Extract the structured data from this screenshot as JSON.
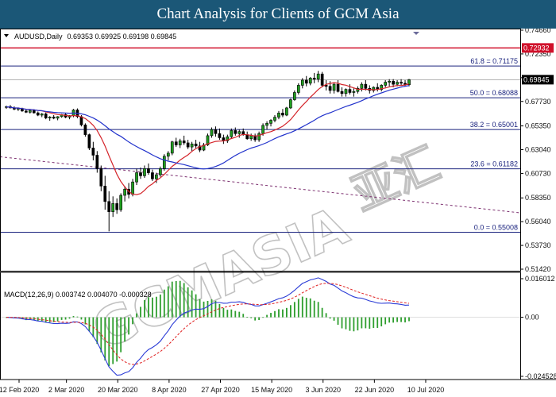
{
  "header": {
    "title": "Chart Analysis for Clients of GCM Asia"
  },
  "info": {
    "symbol": "AUDUSD,Daily",
    "ohlc": "0.69353 0.69925 0.69198 0.69845",
    "macd": "MACD(12,26,9) 0.003742 0.004070 -0.000328"
  },
  "watermark": {
    "text": "GCMASIA",
    "cjk": "亚汇"
  },
  "colors": {
    "bull": "#1f9d1f",
    "bear": "#000000",
    "ma_fast": "#d4242a",
    "ma_slow": "#2233cc",
    "fib": "#1a237e",
    "resistance": "#d0102a",
    "trendline": "#7b2d6e",
    "macd_hist": "#2e9e2e",
    "macd_line": "#2a3bd6",
    "signal_line": "#e02020"
  },
  "chart_data": {
    "type": "candlestick",
    "symbol": "AUDUSD",
    "timeframe": "Daily",
    "ylim": [
      0.5142,
      0.7466
    ],
    "y_ticks": [
      "0.74660",
      "0.72350",
      "0.70040",
      "0.67730",
      "0.65350",
      "0.63040",
      "0.60730",
      "0.58350",
      "0.56040",
      "0.53730",
      "0.51420"
    ],
    "x_ticks": [
      "12 Feb 2020",
      "2 Mar 2020",
      "20 Mar 2020",
      "8 Apr 2020",
      "27 Apr 2020",
      "15 May 2020",
      "3 Jun 2020",
      "22 Jun 2020",
      "10 Jul 2020"
    ],
    "current_price": {
      "value": 0.69845,
      "label": "0.69845"
    },
    "resistance": {
      "value": 0.72932,
      "label": "0.72932"
    },
    "fibonacci": [
      {
        "level": "61.8",
        "value": 0.71175,
        "label": "61.8 = 0.71175"
      },
      {
        "level": "50.0",
        "value": 0.68088,
        "label": "50.0 = 0.68088"
      },
      {
        "level": "38.2",
        "value": 0.65001,
        "label": "38.2 = 0.65001"
      },
      {
        "level": "23.6",
        "value": 0.61182,
        "label": "23.6 = 0.61182"
      },
      {
        "level": "0.0",
        "value": 0.55008,
        "label": "0.0 = 0.55008"
      }
    ],
    "candles": [
      [
        0.6715,
        0.6732,
        0.6702,
        0.6722
      ],
      [
        0.6722,
        0.6738,
        0.6705,
        0.671
      ],
      [
        0.671,
        0.6725,
        0.6688,
        0.6698
      ],
      [
        0.6698,
        0.6715,
        0.668,
        0.6705
      ],
      [
        0.6705,
        0.6712,
        0.6672,
        0.668
      ],
      [
        0.668,
        0.6695,
        0.666,
        0.6668
      ],
      [
        0.6668,
        0.669,
        0.6655,
        0.6685
      ],
      [
        0.6685,
        0.6698,
        0.6655,
        0.6662
      ],
      [
        0.6662,
        0.6675,
        0.663,
        0.664
      ],
      [
        0.664,
        0.666,
        0.662,
        0.6652
      ],
      [
        0.6652,
        0.6665,
        0.66,
        0.6612
      ],
      [
        0.6612,
        0.663,
        0.6585,
        0.6622
      ],
      [
        0.6622,
        0.664,
        0.66,
        0.661
      ],
      [
        0.661,
        0.663,
        0.659,
        0.6625
      ],
      [
        0.6625,
        0.665,
        0.6615,
        0.6645
      ],
      [
        0.6645,
        0.666,
        0.661,
        0.662
      ],
      [
        0.662,
        0.664,
        0.66,
        0.6635
      ],
      [
        0.6635,
        0.67,
        0.662,
        0.669
      ],
      [
        0.669,
        0.6705,
        0.661,
        0.6625
      ],
      [
        0.6625,
        0.664,
        0.653,
        0.6545
      ],
      [
        0.6545,
        0.656,
        0.643,
        0.645
      ],
      [
        0.645,
        0.646,
        0.63,
        0.632
      ],
      [
        0.632,
        0.638,
        0.62,
        0.625
      ],
      [
        0.625,
        0.629,
        0.608,
        0.612
      ],
      [
        0.612,
        0.615,
        0.59,
        0.595
      ],
      [
        0.595,
        0.605,
        0.572,
        0.58
      ],
      [
        0.58,
        0.59,
        0.551,
        0.57
      ],
      [
        0.57,
        0.585,
        0.565,
        0.578
      ],
      [
        0.578,
        0.583,
        0.568,
        0.572
      ],
      [
        0.572,
        0.588,
        0.57,
        0.586
      ],
      [
        0.586,
        0.595,
        0.58,
        0.592
      ],
      [
        0.592,
        0.598,
        0.583,
        0.587
      ],
      [
        0.587,
        0.602,
        0.585,
        0.599
      ],
      [
        0.599,
        0.612,
        0.596,
        0.608
      ],
      [
        0.608,
        0.613,
        0.602,
        0.605
      ],
      [
        0.605,
        0.615,
        0.603,
        0.612
      ],
      [
        0.612,
        0.617,
        0.606,
        0.608
      ],
      [
        0.608,
        0.611,
        0.6,
        0.602
      ],
      [
        0.602,
        0.608,
        0.598,
        0.606
      ],
      [
        0.606,
        0.614,
        0.604,
        0.612
      ],
      [
        0.612,
        0.626,
        0.61,
        0.624
      ],
      [
        0.624,
        0.629,
        0.62,
        0.627
      ],
      [
        0.627,
        0.639,
        0.625,
        0.638
      ],
      [
        0.638,
        0.642,
        0.633,
        0.635
      ],
      [
        0.635,
        0.641,
        0.632,
        0.639
      ],
      [
        0.639,
        0.644,
        0.635,
        0.637
      ],
      [
        0.637,
        0.64,
        0.631,
        0.633
      ],
      [
        0.633,
        0.638,
        0.629,
        0.636
      ],
      [
        0.636,
        0.64,
        0.632,
        0.634
      ],
      [
        0.634,
        0.638,
        0.628,
        0.63
      ],
      [
        0.63,
        0.637,
        0.629,
        0.635
      ],
      [
        0.635,
        0.646,
        0.634,
        0.644
      ],
      [
        0.644,
        0.652,
        0.642,
        0.65
      ],
      [
        0.65,
        0.653,
        0.643,
        0.646
      ],
      [
        0.646,
        0.651,
        0.64,
        0.642
      ],
      [
        0.642,
        0.645,
        0.636,
        0.639
      ],
      [
        0.639,
        0.645,
        0.637,
        0.643
      ],
      [
        0.643,
        0.651,
        0.641,
        0.649
      ],
      [
        0.649,
        0.652,
        0.644,
        0.646
      ],
      [
        0.646,
        0.65,
        0.642,
        0.648
      ],
      [
        0.648,
        0.651,
        0.644,
        0.645
      ],
      [
        0.645,
        0.648,
        0.64,
        0.641
      ],
      [
        0.641,
        0.646,
        0.639,
        0.644
      ],
      [
        0.644,
        0.646,
        0.638,
        0.64
      ],
      [
        0.64,
        0.648,
        0.638,
        0.646
      ],
      [
        0.646,
        0.656,
        0.644,
        0.654
      ],
      [
        0.654,
        0.658,
        0.65,
        0.656
      ],
      [
        0.656,
        0.66,
        0.653,
        0.659
      ],
      [
        0.659,
        0.664,
        0.657,
        0.662
      ],
      [
        0.662,
        0.668,
        0.66,
        0.666
      ],
      [
        0.666,
        0.67,
        0.662,
        0.664
      ],
      [
        0.664,
        0.672,
        0.663,
        0.671
      ],
      [
        0.671,
        0.68,
        0.67,
        0.679
      ],
      [
        0.679,
        0.688,
        0.678,
        0.686
      ],
      [
        0.686,
        0.695,
        0.684,
        0.693
      ],
      [
        0.693,
        0.7,
        0.69,
        0.698
      ],
      [
        0.698,
        0.702,
        0.692,
        0.695
      ],
      [
        0.695,
        0.701,
        0.693,
        0.7
      ],
      [
        0.7,
        0.705,
        0.695,
        0.699
      ],
      [
        0.699,
        0.707,
        0.696,
        0.704
      ],
      [
        0.704,
        0.706,
        0.691,
        0.693
      ],
      [
        0.693,
        0.698,
        0.688,
        0.692
      ],
      [
        0.692,
        0.697,
        0.685,
        0.688
      ],
      [
        0.688,
        0.696,
        0.685,
        0.694
      ],
      [
        0.694,
        0.698,
        0.686,
        0.687
      ],
      [
        0.687,
        0.691,
        0.682,
        0.685
      ],
      [
        0.685,
        0.69,
        0.682,
        0.689
      ],
      [
        0.689,
        0.694,
        0.684,
        0.686
      ],
      [
        0.686,
        0.69,
        0.682,
        0.687
      ],
      [
        0.687,
        0.692,
        0.685,
        0.69
      ],
      [
        0.69,
        0.696,
        0.687,
        0.694
      ],
      [
        0.694,
        0.698,
        0.688,
        0.69
      ],
      [
        0.69,
        0.693,
        0.685,
        0.688
      ],
      [
        0.688,
        0.692,
        0.686,
        0.691
      ],
      [
        0.691,
        0.695,
        0.687,
        0.689
      ],
      [
        0.689,
        0.694,
        0.687,
        0.693
      ],
      [
        0.693,
        0.698,
        0.691,
        0.696
      ],
      [
        0.696,
        0.699,
        0.692,
        0.697
      ],
      [
        0.697,
        0.699,
        0.691,
        0.694
      ],
      [
        0.694,
        0.698,
        0.692,
        0.696
      ],
      [
        0.696,
        0.699,
        0.693,
        0.695
      ],
      [
        0.695,
        0.698,
        0.692,
        0.694
      ],
      [
        0.69353,
        0.69925,
        0.69198,
        0.69845
      ]
    ],
    "moving_averages": [
      {
        "period": 10,
        "color": "#d4242a"
      },
      {
        "period": 30,
        "color": "#2233cc"
      }
    ],
    "trendline": {
      "start_value": 0.6235,
      "end_value": 0.569
    },
    "macd": {
      "label": "MACD(12,26,9) 0.003742 0.004070 -0.000328",
      "ylim": [
        -0.024528,
        0.016012
      ],
      "y_ticks": [
        "0.016012",
        "0.00",
        "-0.024528"
      ],
      "macd_value": 0.003742,
      "signal_value": 0.00407,
      "histogram_value": -0.000328
    }
  }
}
